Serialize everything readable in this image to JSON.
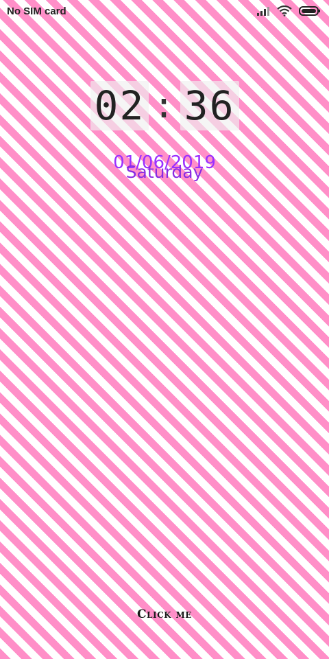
{
  "status_bar": {
    "carrier": "No SIM card",
    "icons": [
      "signal-icon",
      "wifi-icon",
      "battery-icon"
    ]
  },
  "clock": {
    "hours": "02",
    "separator": ":",
    "minutes": "36"
  },
  "date": {
    "date_text": "01/06/2019",
    "day_text": "Saturday"
  },
  "action": {
    "button_label": "Click me"
  },
  "colors": {
    "stripe_pink": "#ff8fc8",
    "stripe_white": "#ffffff",
    "date_purple": "#9b30ff"
  }
}
